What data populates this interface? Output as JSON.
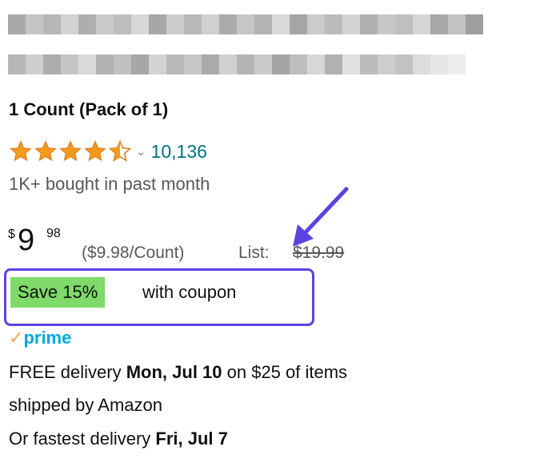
{
  "product": {
    "size_label": "1 Count (Pack of 1)",
    "rating": 4.5,
    "rating_max": 5,
    "review_count": "10,136",
    "bought_text": "1K+ bought in past month"
  },
  "price": {
    "symbol": "$",
    "whole": "9",
    "fraction": "98",
    "unit_price": "($9.98/Count)",
    "list_label": "List:",
    "list_price": "$19.99"
  },
  "coupon": {
    "badge": "Save 15%",
    "text": "with coupon"
  },
  "prime": {
    "check": "✓",
    "label": "prime"
  },
  "delivery": {
    "line1_prefix": "FREE delivery ",
    "line1_date": "Mon, Jul 10",
    "line1_suffix": " on $25 of items",
    "line2": "shipped by Amazon",
    "line3_prefix": "Or fastest delivery ",
    "line3_date": "Fri, Jul 7"
  },
  "colors": {
    "star": "#f29a1a",
    "link": "#007185",
    "coupon_green": "#7fda69",
    "annotation": "#5b43e0",
    "prime_blue": "#00a8e1"
  },
  "icons": [
    "star-icon",
    "chevron-down-icon",
    "annotation-arrow-icon",
    "prime-check-icon"
  ]
}
